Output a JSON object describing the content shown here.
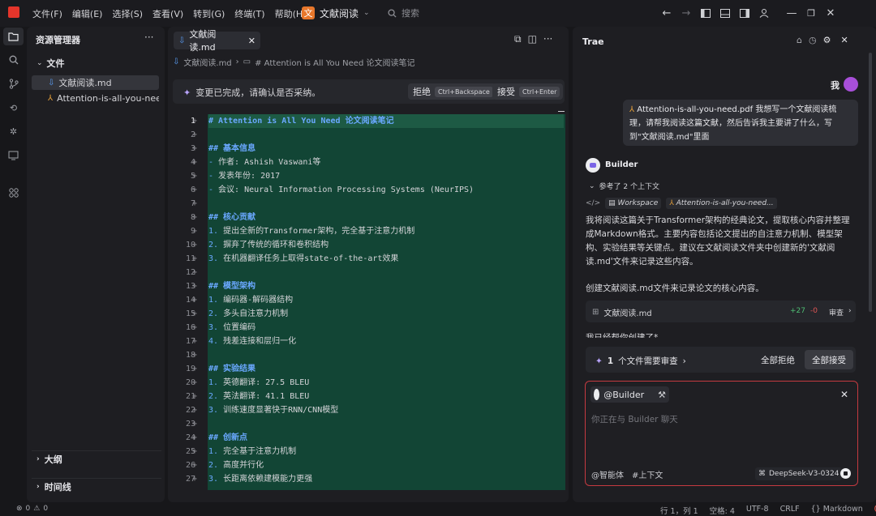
{
  "menu": [
    "文件(F)",
    "编辑(E)",
    "选择(S)",
    "查看(V)",
    "转到(G)",
    "终端(T)",
    "帮助(H)"
  ],
  "project": {
    "badge": "文",
    "name": "文献阅读"
  },
  "search": {
    "placeholder": "搜索"
  },
  "explorer": {
    "title": "资源管理器",
    "folder": "文件",
    "files": [
      "文献阅读.md",
      "Attention-is-all-you-nee..."
    ],
    "sections": [
      "大纲",
      "时间线"
    ]
  },
  "editor": {
    "tab": "文献阅读.md",
    "breadcrumb": {
      "file": "文献阅读.md",
      "symbol": "# Attention is All You Need 论文阅读笔记"
    },
    "review": {
      "message": "变更已完成，请确认是否采纳。",
      "reject": "拒绝",
      "reject_key": "Ctrl+Backspace",
      "accept": "接受",
      "accept_key": "Ctrl+Enter"
    },
    "lines": [
      "# Attention is All You Need 论文阅读笔记",
      "",
      "## 基本信息",
      "- 作者: Ashish Vaswani等",
      "- 发表年份: 2017",
      "- 会议: Neural Information Processing Systems (NeurIPS)",
      "",
      "## 核心贡献",
      "1. 提出全新的Transformer架构，完全基于注意力机制",
      "2. 摒弃了传统的循环和卷积结构",
      "3. 在机器翻译任务上取得state-of-the-art效果",
      "",
      "## 模型架构",
      "1. 编码器-解码器结构",
      "2. 多头自注意力机制",
      "3. 位置编码",
      "4. 残差连接和层归一化",
      "",
      "## 实验结果",
      "1. 英德翻译: 27.5 BLEU",
      "2. 英法翻译: 41.1 BLEU",
      "3. 训练速度显著快于RNN/CNN模型",
      "",
      "## 创新点",
      "1. 完全基于注意力机制",
      "2. 高度并行化",
      "3. 长距离依赖建模能力更强"
    ]
  },
  "chat": {
    "title": "Trae",
    "me": "我",
    "user_file": "Attention-is-all-you-need.pdf",
    "user_message": "我想写一个文献阅读梳理，请帮我阅读这篇文献，然后告诉我主要讲了什么，写到\"文献阅读.md\"里面",
    "agent": "Builder",
    "context_ref": "参考了 2 个上下文",
    "context_chips": [
      "Workspace",
      "Attention-is-all-you-need..."
    ],
    "reply": "我将阅读这篇关于Transformer架构的经典论文，提取核心内容并整理成Markdown格式。主要内容包括论文提出的自注意力机制、模型架构、实验结果等关键点。建议在文献阅读文件夹中创建新的'文献阅读.md'文件来记录这些内容。",
    "reply2": "创建文献阅读.md文件来记录论文的核心内容。",
    "file_card": {
      "name": "文献阅读.md",
      "added": "+27",
      "removed": "-0",
      "review": "审查"
    },
    "cut_text": "我已经帮你创建了*",
    "pending": {
      "count": "1",
      "text": "个文件需要审查",
      "reject_all": "全部拒绝",
      "accept_all": "全部接受"
    },
    "input": {
      "mention": "@Builder",
      "placeholder": "你正在与 Builder 聊天",
      "agent_btn": "@智能体",
      "context_btn": "#上下文",
      "model": "DeepSeek-V3-0324"
    }
  },
  "status": {
    "errors": "0",
    "warnings": "0",
    "position": "行 1，列 1",
    "spaces": "空格: 4",
    "encoding": "UTF-8",
    "eol": "CRLF",
    "language": "Markdown"
  }
}
